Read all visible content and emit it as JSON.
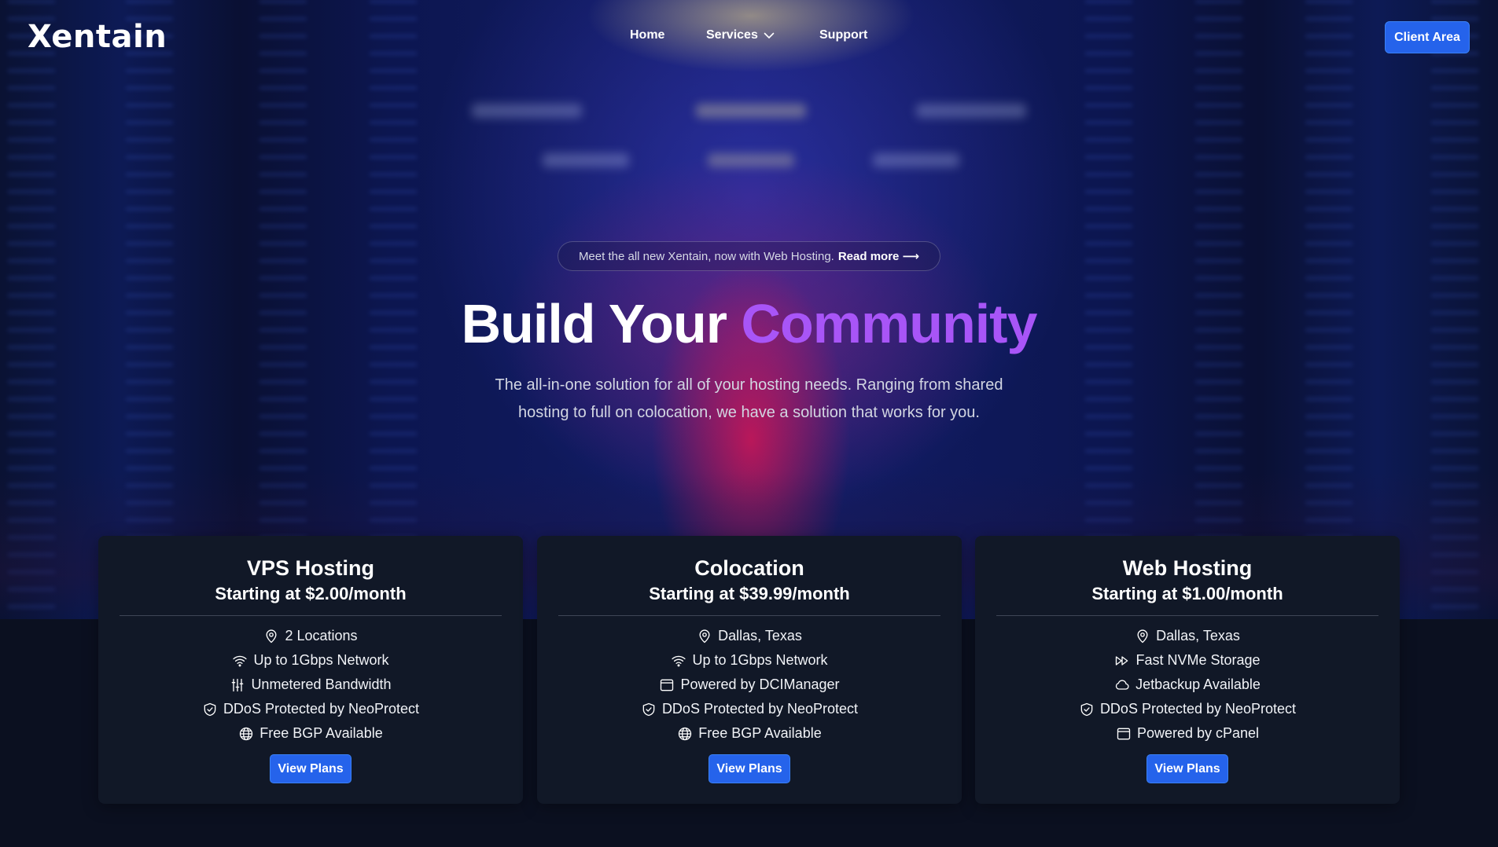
{
  "header": {
    "logo": "Xentain",
    "nav": {
      "home": "Home",
      "services": "Services",
      "support": "Support"
    },
    "client_area": "Client Area"
  },
  "hero": {
    "announcement": "Meet the all new Xentain, now with Web Hosting.",
    "read_more": "Read more ⟶",
    "headline_plain": "Build Your",
    "headline_accent": "Community",
    "subtitle": "The all-in-one solution for all of your hosting needs. Ranging from shared hosting to full on colocation, we have a solution that works for you."
  },
  "cards": [
    {
      "title": "VPS Hosting",
      "price": "Starting at $2.00/month",
      "features": [
        {
          "icon": "location-pin-icon",
          "text": "2 Locations"
        },
        {
          "icon": "wifi-icon",
          "text": "Up to 1Gbps Network"
        },
        {
          "icon": "sliders-icon",
          "text": "Unmetered Bandwidth"
        },
        {
          "icon": "shield-check-icon",
          "text": "DDoS Protected by NeoProtect"
        },
        {
          "icon": "globe-icon",
          "text": "Free BGP Available"
        }
      ],
      "button": "View Plans"
    },
    {
      "title": "Colocation",
      "price": "Starting at $39.99/month",
      "features": [
        {
          "icon": "location-pin-icon",
          "text": "Dallas, Texas"
        },
        {
          "icon": "wifi-icon",
          "text": "Up to 1Gbps Network"
        },
        {
          "icon": "browser-window-icon",
          "text": "Powered by DCIManager"
        },
        {
          "icon": "shield-check-icon",
          "text": "DDoS Protected by NeoProtect"
        },
        {
          "icon": "globe-icon",
          "text": "Free BGP Available"
        }
      ],
      "button": "View Plans"
    },
    {
      "title": "Web Hosting",
      "price": "Starting at $1.00/month",
      "features": [
        {
          "icon": "location-pin-icon",
          "text": "Dallas, Texas"
        },
        {
          "icon": "fast-forward-icon",
          "text": "Fast NVMe Storage"
        },
        {
          "icon": "cloud-icon",
          "text": "Jetbackup Available"
        },
        {
          "icon": "shield-check-icon",
          "text": "DDoS Protected by NeoProtect"
        },
        {
          "icon": "browser-window-icon",
          "text": "Powered by cPanel"
        }
      ],
      "button": "View Plans"
    }
  ],
  "colors": {
    "accent_purple": "#a855f7",
    "button_blue": "#2563eb",
    "card_bg": "#111827",
    "page_bg": "#0b1020"
  }
}
